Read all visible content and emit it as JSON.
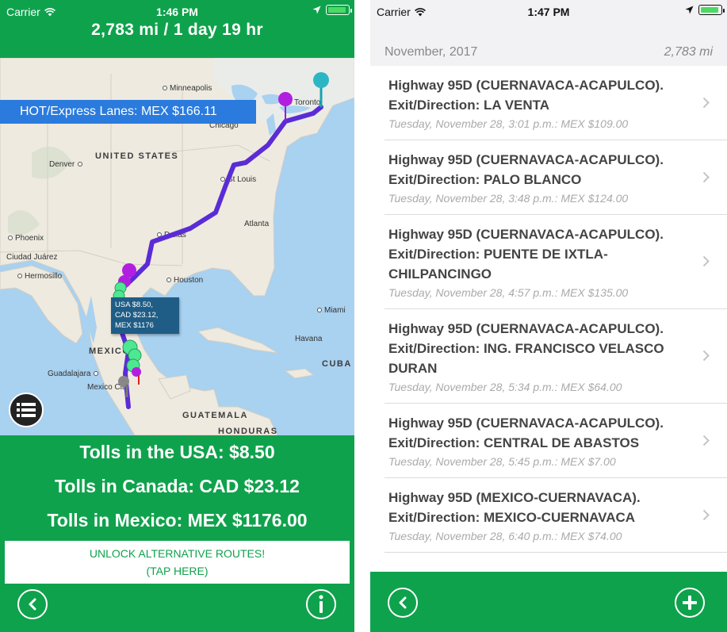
{
  "left": {
    "status": {
      "carrier": "Carrier",
      "time": "1:46 PM"
    },
    "trip_summary": "2,783 mi / 1 day 19 hr",
    "hot_banner": "HOT/Express Lanes: MEX $166.11",
    "map_labels": {
      "minneapolis": "Minneapolis",
      "toronto": "Toronto",
      "chicago": "Chicago",
      "united_states": "UNITED STATES",
      "denver": "Denver",
      "st_louis": "St Louis",
      "atlanta": "Atlanta",
      "phoenix": "Phoenix",
      "dallas": "Dallas",
      "ciudad_juarez": "Ciudad Juárez",
      "hermosillo": "Hermosillo",
      "houston": "Houston",
      "miami": "Miami",
      "mexico": "MEXICO",
      "havana": "Havana",
      "cuba": "CUBA",
      "guadalajara": "Guadalajara",
      "mexico_city": "Mexico City",
      "guatemala": "GUATEMALA",
      "honduras": "HONDURAS"
    },
    "callout": [
      "USA $8.50,",
      "CAD $23.12,",
      "MEX $1176"
    ],
    "tolls": {
      "usa": "Tolls in the USA: $8.50",
      "canada": "Tolls in Canada: CAD $23.12",
      "mexico": "Tolls in Mexico: MEX $1176.00"
    },
    "unlock": {
      "line1": "UNLOCK ALTERNATIVE ROUTES!",
      "line2": "(TAP HERE)"
    }
  },
  "right": {
    "status": {
      "carrier": "Carrier",
      "time": "1:47 PM"
    },
    "section": {
      "month": "November, 2017",
      "total": "2,783 mi"
    },
    "rows": [
      {
        "title": "Highway 95D (CUERNAVACA-ACAPULCO). Exit/Direction: LA VENTA",
        "detail": "Tuesday, November 28, 3:01 p.m.: MEX $109.00"
      },
      {
        "title": "Highway 95D (CUERNAVACA-ACAPULCO). Exit/Direction: PALO BLANCO",
        "detail": "Tuesday, November 28, 3:48 p.m.: MEX $124.00"
      },
      {
        "title": "Highway 95D (CUERNAVACA-ACAPULCO). Exit/Direction: PUENTE DE IXTLA-CHILPANCINGO",
        "detail": "Tuesday, November 28, 4:57 p.m.: MEX $135.00"
      },
      {
        "title": "Highway 95D (CUERNAVACA-ACAPULCO). Exit/Direction: ING. FRANCISCO VELASCO DURAN",
        "detail": "Tuesday, November 28, 5:34 p.m.: MEX $64.00"
      },
      {
        "title": "Highway 95D (CUERNAVACA-ACAPULCO). Exit/Direction: CENTRAL DE ABASTOS",
        "detail": "Tuesday, November 28, 5:45 p.m.: MEX $7.00"
      },
      {
        "title": "Highway 95D (MEXICO-CUERNAVACA). Exit/Direction: MEXICO-CUERNAVACA",
        "detail": "Tuesday, November 28, 6:40 p.m.: MEX $74.00"
      }
    ]
  },
  "colors": {
    "brand_green": "#0fa24c",
    "banner_blue": "#2a7bdd",
    "route_purple": "#5b2bd6",
    "callout_blue": "#1f5d86"
  },
  "icons": [
    "wifi-icon",
    "location-arrow-icon",
    "battery-icon",
    "list-icon",
    "back-chevron-icon",
    "info-icon",
    "plus-icon",
    "chevron-right-icon"
  ]
}
